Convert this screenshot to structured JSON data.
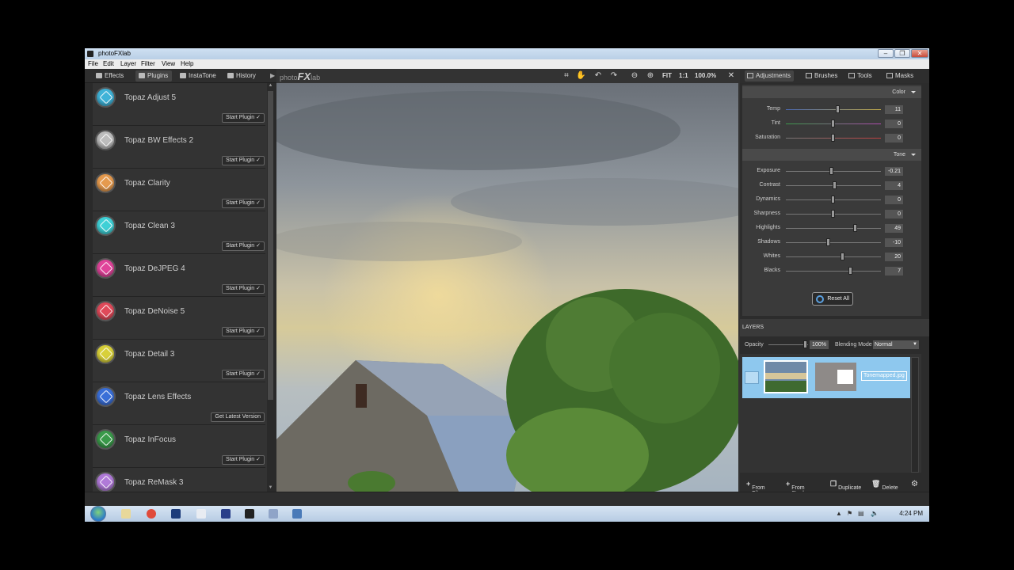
{
  "window": {
    "title": "photoFXlab"
  },
  "menu": [
    "File",
    "Edit",
    "Layer",
    "Filter",
    "View",
    "Help"
  ],
  "left_tabs": [
    "Effects",
    "Plugins",
    "InstaTone",
    "History"
  ],
  "plugins": [
    {
      "name": "Topaz Adjust 5",
      "button": "Start Plugin ✓",
      "color": "#3fb3d8"
    },
    {
      "name": "Topaz BW Effects 2",
      "button": "Start Plugin ✓",
      "color": "#bdbdbd"
    },
    {
      "name": "Topaz Clarity",
      "button": "Start Plugin ✓",
      "color": "#e59a4e"
    },
    {
      "name": "Topaz Clean 3",
      "button": "Start Plugin ✓",
      "color": "#3fd0d6"
    },
    {
      "name": "Topaz DeJPEG 4",
      "button": "Start Plugin ✓",
      "color": "#e0449a"
    },
    {
      "name": "Topaz DeNoise 5",
      "button": "Start Plugin ✓",
      "color": "#e04a5a"
    },
    {
      "name": "Topaz Detail 3",
      "button": "Start Plugin ✓",
      "color": "#d8d03a"
    },
    {
      "name": "Topaz Lens Effects",
      "button": "Get Latest Version",
      "color": "#3a6fd8"
    },
    {
      "name": "Topaz InFocus",
      "button": "Start Plugin ✓",
      "color": "#3a9a4a"
    },
    {
      "name": "Topaz ReMask 3",
      "button": "",
      "color": "#b07ad8"
    }
  ],
  "canvas_toolbar": {
    "logo_prefix": "photo",
    "logo_fx": "FX",
    "logo_suffix": "lab",
    "fit": "FIT",
    "one_to_one": "1:1",
    "zoom": "100.0%"
  },
  "right_tabs": [
    "Adjustments",
    "Brushes",
    "Tools",
    "Masks"
  ],
  "adjustments": {
    "color_section": "Color",
    "color": [
      {
        "label": "Temp",
        "value": "11",
        "fraction": 0.55
      },
      {
        "label": "Tint",
        "value": "0",
        "fraction": 0.5
      },
      {
        "label": "Saturation",
        "value": "0",
        "fraction": 0.5
      }
    ],
    "tone_section": "Tone",
    "tone": [
      {
        "label": "Exposure",
        "value": "-0.21",
        "fraction": 0.48
      },
      {
        "label": "Contrast",
        "value": "4",
        "fraction": 0.52
      },
      {
        "label": "Dynamics",
        "value": "0",
        "fraction": 0.5
      },
      {
        "label": "Sharpness",
        "value": "0",
        "fraction": 0.5
      },
      {
        "label": "Highlights",
        "value": "49",
        "fraction": 0.73
      },
      {
        "label": "Shadows",
        "value": "-10",
        "fraction": 0.45
      },
      {
        "label": "Whites",
        "value": "20",
        "fraction": 0.6
      },
      {
        "label": "Blacks",
        "value": "7",
        "fraction": 0.68
      }
    ],
    "reset": "Reset All"
  },
  "layers": {
    "heading": "LAYERS",
    "opacity_label": "Opacity",
    "opacity_value": "100%",
    "blending_label": "Blending Mode",
    "blending_value": "Normal",
    "layer_name": "Tonemapped.jpg"
  },
  "bottom_actions": [
    "From File",
    "From Stack",
    "Duplicate",
    "Delete"
  ],
  "taskbar": {
    "clock": "4:24 PM"
  }
}
